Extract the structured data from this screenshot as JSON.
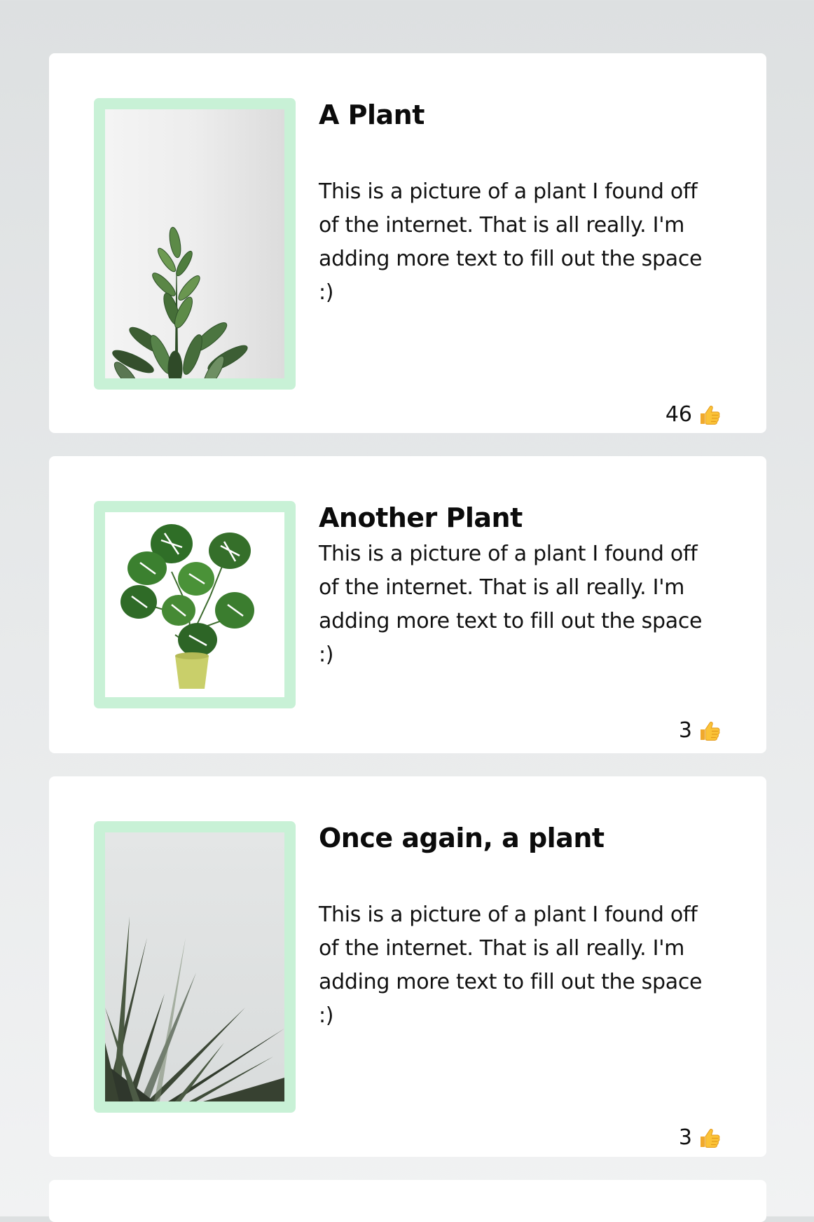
{
  "posts": [
    {
      "title": "A Plant",
      "description": "This is a picture of a plant I found off of the internet. That is all really. I'm adding more text to fill out the space :)",
      "likes": "46",
      "like_icon": "thumbs-up-icon"
    },
    {
      "title": "Another Plant",
      "description": "This is a picture of a plant I found off of the internet. That is all really. I'm adding more text to fill out the space :)",
      "likes": "3",
      "like_icon": "thumbs-up-icon"
    },
    {
      "title": "Once again, a plant",
      "description": "This is a picture of a plant I found off of the internet. That is all really. I'm adding more text to fill out the space :)",
      "likes": "3",
      "like_icon": "thumbs-up-icon"
    }
  ],
  "colors": {
    "page_background": "#e3e5e6",
    "card_background": "#ffffff",
    "image_frame": "#c8f1d6",
    "text": "#111111"
  }
}
